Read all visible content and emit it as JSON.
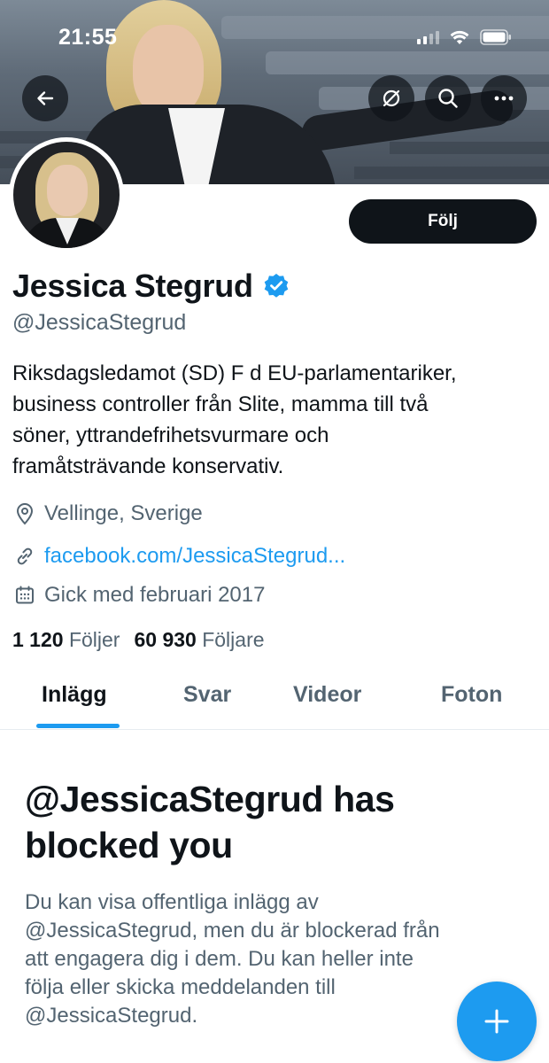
{
  "status_bar": {
    "time": "21:55",
    "icons": [
      "signal-icon",
      "wifi-icon",
      "battery-icon"
    ]
  },
  "header": {
    "buttons": [
      "back-arrow-icon",
      "sync-off-icon",
      "search-icon",
      "more-icon"
    ]
  },
  "profile": {
    "follow_label": "Följ",
    "display_name": "Jessica Stegrud",
    "verified": true,
    "handle": "@JessicaStegrud",
    "bio_lines": [
      "Riksdagsledamot (SD) F d EU-parlamentariker,",
      "business controller från Slite, mamma till två",
      "söner, yttrandefrihetsvurmare och",
      "framåtsträvande konservativ."
    ],
    "location": "Vellinge, Sverige",
    "link": "facebook.com/JessicaStegrud...",
    "joined": "Gick med februari 2017",
    "following_count": "1 120",
    "following_label": "Följer",
    "followers_count": "60 930",
    "followers_label": "Följare"
  },
  "tabs": [
    {
      "label": "Inlägg",
      "active": true
    },
    {
      "label": "Svar",
      "active": false
    },
    {
      "label": "Videor",
      "active": false
    },
    {
      "label": "Foton",
      "active": false
    }
  ],
  "blocked": {
    "title_lines": [
      "@JessicaStegrud has",
      "blocked you"
    ],
    "text_lines": [
      "Du kan visa offentliga inlägg av",
      "@JessicaStegrud, men du är blockerad från",
      "att engagera dig i dem. Du kan heller inte",
      "följa eller skicka meddelanden till",
      "@JessicaStegrud."
    ]
  },
  "fab": {
    "icon": "plus-icon"
  },
  "colors": {
    "accent": "#1d9bf0",
    "primary_text": "#0f1419",
    "secondary_text": "#536471"
  }
}
